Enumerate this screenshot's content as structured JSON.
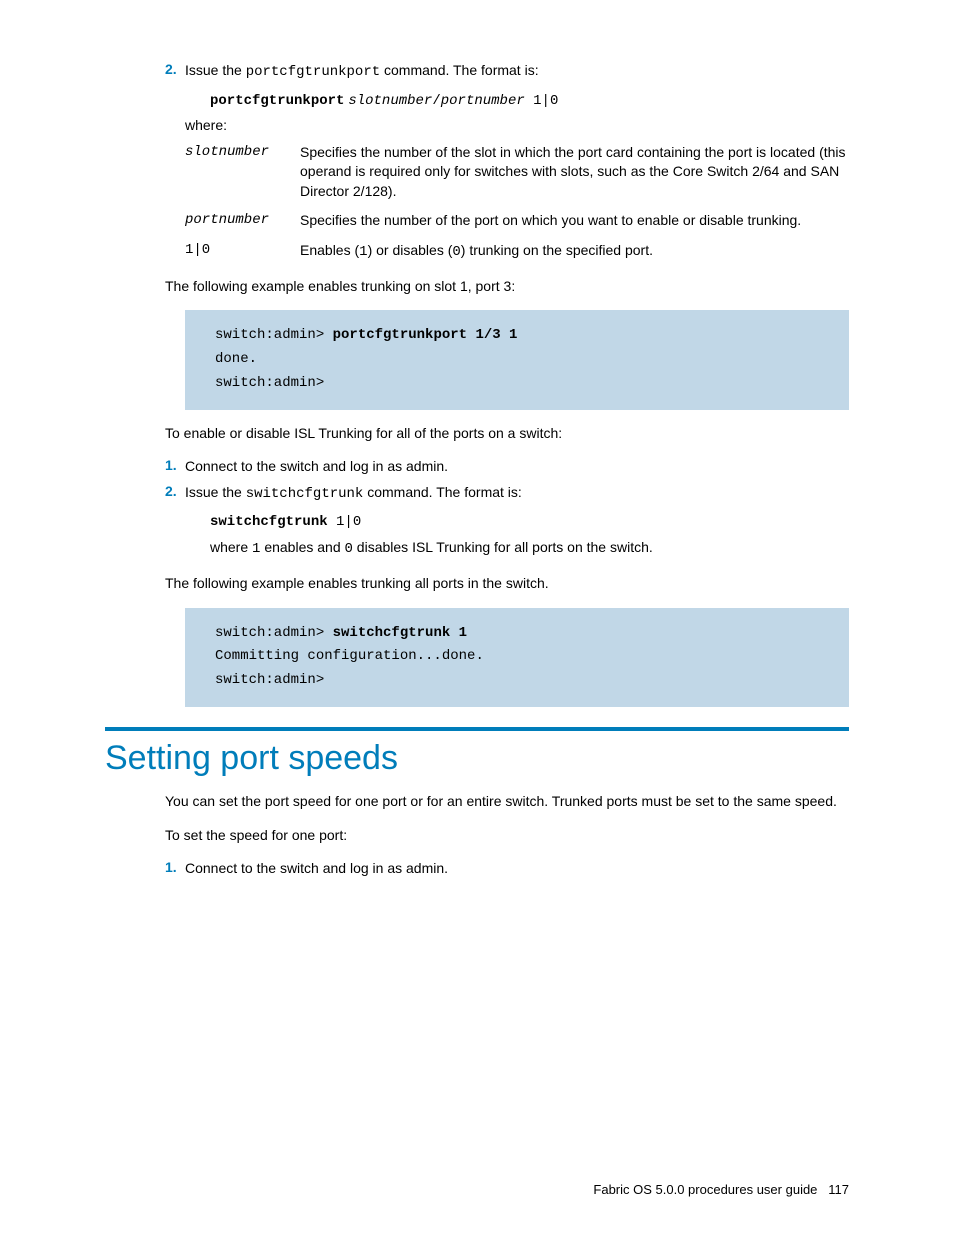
{
  "step2": {
    "num": "2.",
    "text_before": "Issue the ",
    "cmd": "portcfgtrunkport",
    "text_after": " command. The format is:"
  },
  "syntax1": {
    "cmd": "portcfgtrunkport",
    "arg1": "slotnumber",
    "sep": "/",
    "arg2": "portnumber",
    "tail": " 1|0"
  },
  "where_label": "where:",
  "params": [
    {
      "term": "slotnumber",
      "term_style": "italic",
      "desc": "Specifies the number of the slot in which the port card containing the port is located (this operand is required only for switches with slots, such as the Core Switch 2/64 and SAN Director 2/128)."
    },
    {
      "term": "portnumber",
      "term_style": "italic",
      "desc": "Specifies the number of the port on which you want to enable or disable trunking."
    },
    {
      "term": "1|0",
      "term_style": "plain",
      "desc_parts": [
        "Enables (",
        "1",
        ") or disables (",
        "0",
        ") trunking on the specified port."
      ]
    }
  ],
  "example1_intro": "The following example enables trunking on slot 1, port 3:",
  "code1": {
    "line1_prompt": "switch:admin> ",
    "line1_cmd": "portcfgtrunkport 1/3 1",
    "line2": "done.",
    "line3": "switch:admin>"
  },
  "para2": "To enable or disable ISL Trunking for all of the ports on a switch:",
  "step_b1": {
    "num": "1.",
    "text": "Connect to the switch and log in as admin."
  },
  "step_b2": {
    "num": "2.",
    "text_before": "Issue the ",
    "cmd": "switchcfgtrunk",
    "text_after": " command. The format is:"
  },
  "syntax2": {
    "cmd": "switchcfgtrunk",
    "tail": " 1|0"
  },
  "syntax2_explain": {
    "p1": "where ",
    "c1": "1",
    "p2": " enables and ",
    "c2": "0",
    "p3": " disables ISL Trunking for all ports on the switch."
  },
  "example2_intro": "The following example enables trunking all ports in the switch.",
  "code2": {
    "line1_prompt": "switch:admin> ",
    "line1_cmd": "switchcfgtrunk 1",
    "line2": "Committing configuration...done.",
    "line3": "switch:admin>"
  },
  "heading": "Setting port speeds",
  "sec_p1": "You can set the port speed for one port or for an entire switch. Trunked ports must be set to the same speed.",
  "sec_p2": "To set the speed for one port:",
  "step_c1": {
    "num": "1.",
    "text": "Connect to the switch and log in as admin."
  },
  "footer": {
    "title": "Fabric OS 5.0.0 procedures user guide",
    "page": "117"
  }
}
